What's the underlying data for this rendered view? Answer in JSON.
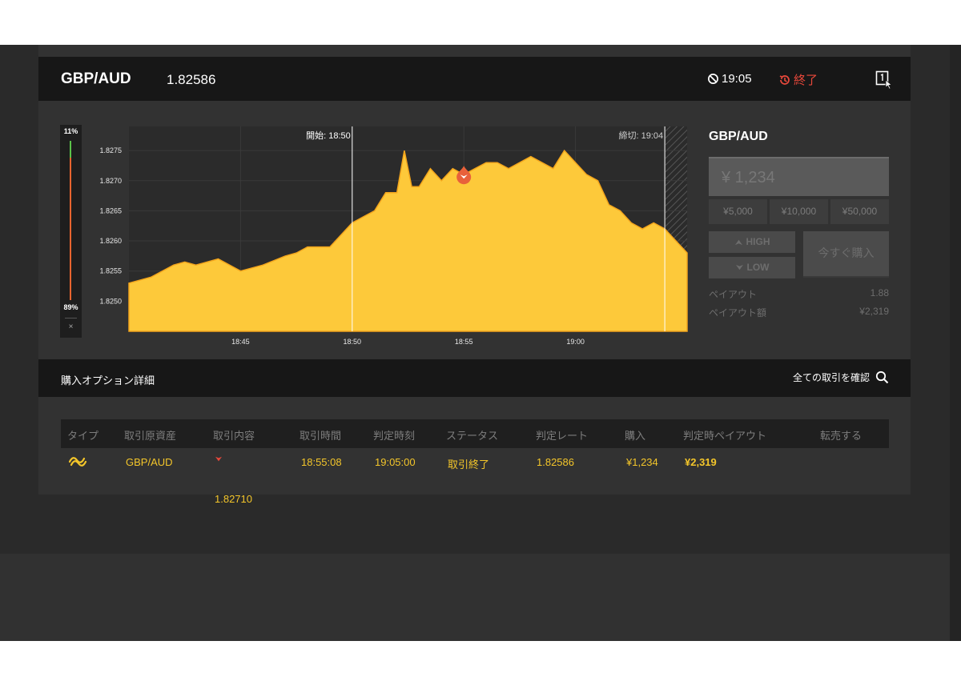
{
  "colors": {
    "accent": "#f4c62a",
    "chart_fill": "#fdc93a",
    "chart_line": "#f3a51c",
    "negative": "#e8483b",
    "panel": "#323232",
    "bar": "#171717"
  },
  "header": {
    "pair": "GBP/AUD",
    "rate": "1.82586",
    "timer_icon": "prohibited-clock-icon",
    "timer": "19:05",
    "ended_icon": "history-icon",
    "ended": "終了",
    "cursor_icon": "window-cursor-icon"
  },
  "gauge": {
    "top_percent": "11%",
    "bottom_percent": "89%",
    "close": "×",
    "up_fraction": 0.11,
    "down_fraction": 0.89
  },
  "chart_data": {
    "type": "area",
    "x_ticks": [
      "18:45",
      "18:50",
      "18:55",
      "19:00"
    ],
    "y_ticks": [
      "1.8250",
      "1.8255",
      "1.8260",
      "1.8265",
      "1.8270",
      "1.8275"
    ],
    "ylim": [
      1.8245,
      1.8279
    ],
    "xlim": [
      "18:40",
      "19:05"
    ],
    "start_label": "開始: 18:50",
    "end_label": "締切: 19:04",
    "marker": {
      "time": "18:55",
      "value": 1.8271,
      "direction": "LOW"
    },
    "grid": true,
    "series": [
      {
        "x": [
          "18:40",
          "18:41",
          "18:42",
          "18:42:30",
          "18:43",
          "18:44",
          "18:45",
          "18:46",
          "18:47",
          "18:47:30",
          "18:48",
          "18:49",
          "18:49:30",
          "18:50",
          "18:50:30",
          "18:51",
          "18:51:30",
          "18:52",
          "18:52:20",
          "18:52:40",
          "18:53",
          "18:53:30",
          "18:54",
          "18:54:30",
          "18:55",
          "18:55:30",
          "18:56",
          "18:56:30",
          "18:57",
          "18:57:30",
          "18:58",
          "18:59",
          "18:59:30",
          "19:00",
          "19:00:30",
          "19:01",
          "19:01:30",
          "19:02",
          "19:02:30",
          "19:03",
          "19:03:30",
          "19:04",
          "19:04:30",
          "19:05"
        ],
        "values": [
          1.8253,
          1.8254,
          1.8256,
          1.82565,
          1.8256,
          1.8257,
          1.8255,
          1.8256,
          1.82575,
          1.8258,
          1.8259,
          1.8259,
          1.8261,
          1.8263,
          1.8264,
          1.8265,
          1.8268,
          1.8268,
          1.8275,
          1.8269,
          1.8269,
          1.8272,
          1.827,
          1.8272,
          1.8271,
          1.8272,
          1.8273,
          1.8273,
          1.8272,
          1.8273,
          1.8274,
          1.8272,
          1.8275,
          1.8273,
          1.8271,
          1.827,
          1.8266,
          1.8265,
          1.8263,
          1.8262,
          1.8263,
          1.8262,
          1.826,
          1.8258
        ]
      }
    ]
  },
  "trade": {
    "title": "GBP/AUD",
    "amount": "¥ 1,234",
    "quick": [
      "¥5,000",
      "¥10,000",
      "¥50,000"
    ],
    "high": "HIGH",
    "high_icon": "arrow-up-icon",
    "low": "LOW",
    "low_icon": "arrow-down-icon",
    "buy_now": "今すぐ購入",
    "payout_label": "ペイアウト",
    "payout_value": "1.88",
    "payout_amount_label": "ペイアウト額",
    "payout_amount_value": "¥2,319"
  },
  "options": {
    "title": "購入オプション詳細",
    "view_all": "全ての取引を確認",
    "search_icon": "search-icon"
  },
  "table": {
    "headers": [
      "タイプ",
      "取引原資産",
      "取引内容",
      "取引時間",
      "判定時刻",
      "ステータス",
      "判定レート",
      "購入",
      "判定時ペイアウト",
      "転売する"
    ],
    "row": {
      "type_icon": "exchange-icon",
      "asset": "GBP/AUD",
      "direction_icon": "arrow-down-icon",
      "content": "1.82710",
      "trade_time": "18:55:08",
      "judgment_time": "19:05:00",
      "status": "取引終了",
      "rate": "1.82586",
      "purchase": "¥1,234",
      "payout": "¥2,319",
      "resell": ""
    }
  }
}
